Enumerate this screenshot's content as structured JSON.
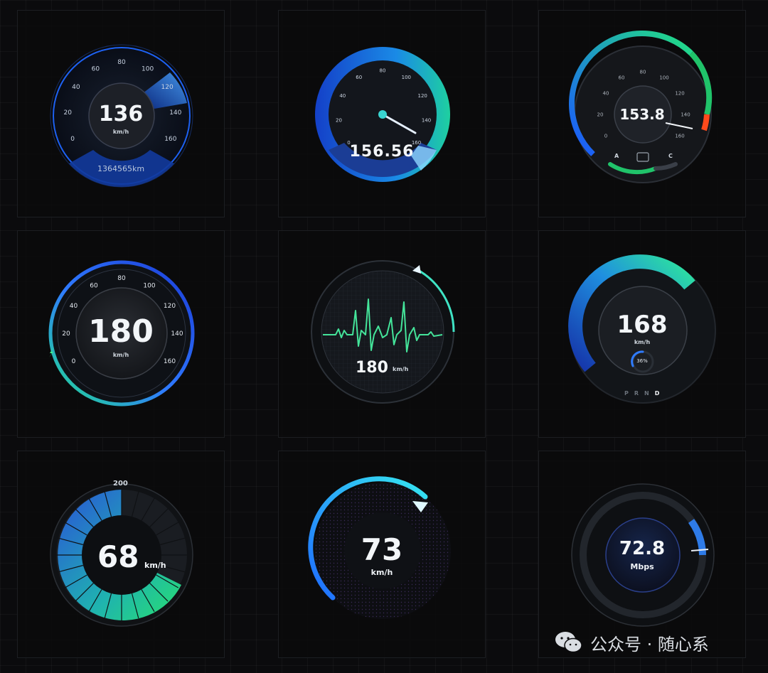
{
  "gauges": [
    {
      "style": "blue-dial",
      "value": "136",
      "unit": "km/h",
      "odometer": "1364565km",
      "ticks": [
        "0",
        "20",
        "40",
        "60",
        "80",
        "100",
        "120",
        "140",
        "160"
      ],
      "accent": "#1e6bff"
    },
    {
      "style": "blue-green-needle",
      "value": "156.56",
      "ticks": [
        "0",
        "20",
        "40",
        "60",
        "80",
        "100",
        "120",
        "140",
        "160"
      ],
      "accent": "#1ec9a8"
    },
    {
      "style": "green-arc-fuel",
      "value": "153.8",
      "ticks": [
        "0",
        "20",
        "40",
        "60",
        "80",
        "100",
        "120",
        "140",
        "160"
      ],
      "fuel_labels": [
        "A",
        "C"
      ],
      "accent": "#1fd17a"
    },
    {
      "style": "blue-ring",
      "value": "180",
      "unit": "km/h",
      "ticks": [
        "0",
        "20",
        "40",
        "60",
        "80",
        "100",
        "120",
        "140",
        "160"
      ],
      "accent": "#2f7bff"
    },
    {
      "style": "heartbeat",
      "value": "180",
      "unit": "km/h",
      "accent": "#41e39a"
    },
    {
      "style": "gear-gauge",
      "value": "168",
      "unit": "km/h",
      "percent": "36%",
      "gears": [
        "P",
        "R",
        "N",
        "D"
      ],
      "active_gear": "D",
      "accent": "#24d1a0"
    },
    {
      "style": "segmented-green",
      "value": "68",
      "unit": "km/h",
      "max": "200",
      "accent": "#28e070"
    },
    {
      "style": "cyan-arc",
      "value": "73",
      "unit": "km/h",
      "accent": "#2fd7ee"
    },
    {
      "style": "network-speed",
      "value": "72.8",
      "unit": "Mbps",
      "accent": "#3a8cff"
    }
  ],
  "watermark": {
    "text": "公众号 · 随心系",
    "icon": "wechat-icon"
  }
}
